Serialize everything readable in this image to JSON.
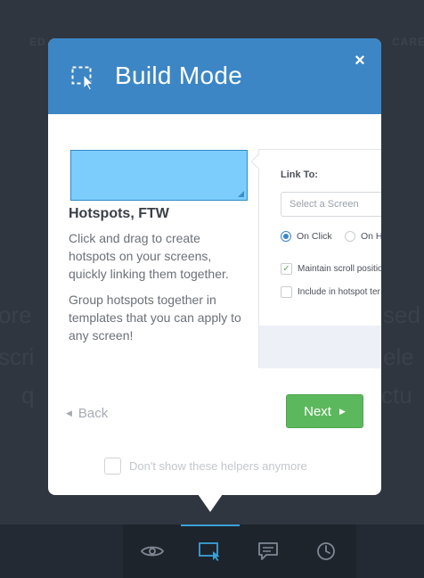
{
  "background": {
    "nav": [
      "ED",
      "CARE"
    ],
    "words": [
      "ore",
      "sed",
      "scri",
      "ele",
      "q",
      "ctu"
    ]
  },
  "modal": {
    "title": "Build Mode",
    "close_label": "×",
    "header_icon": "hotspot-cursor-icon",
    "header_color": "#3c86c6",
    "feature": {
      "title": "Hotspots, FTW",
      "description": "Click and drag to create hotspots on your screens, quickly linking them together.",
      "description2": "Group hotspots together in templates that you can apply to any screen!"
    },
    "panel": {
      "link_to_label": "Link To:",
      "select_placeholder": "Select a Screen",
      "radio_on_click": "On Click",
      "radio_on_hover": "On H",
      "checkbox_maintain": "Maintain scroll positio",
      "checkbox_include": "Include in hotspot ter"
    },
    "back_label": "Back",
    "next_label": "Next",
    "next_color": "#5cb85c",
    "dont_show_label": "Don't show these helpers anymore"
  },
  "toolbar": {
    "tools": [
      "eye-icon",
      "build-mode-icon",
      "comment-icon",
      "history-icon"
    ],
    "active_color": "#3aa0d8"
  }
}
